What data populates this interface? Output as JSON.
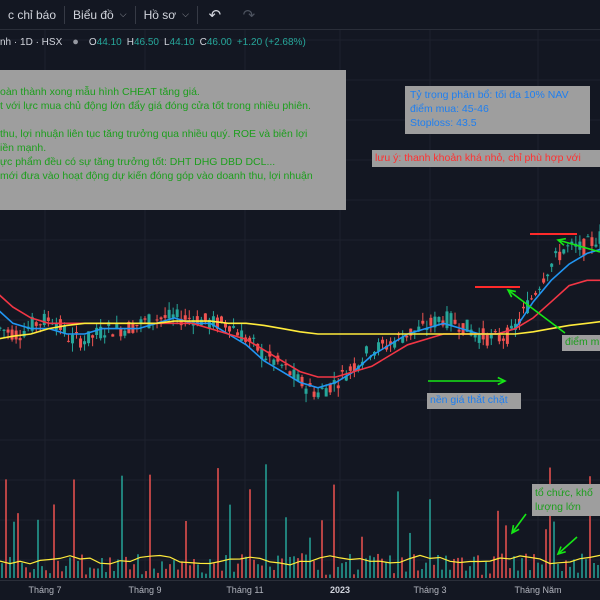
{
  "toolbar": {
    "indicators_label": "c chỉ báo",
    "chart_label": "Biểu đồ",
    "profile_label": "Hồ sơ",
    "undo_icon": "undo-icon",
    "redo_icon": "redo-icon"
  },
  "legend": {
    "symbol": "nh · 1D · HSX",
    "o_label": "O",
    "o_value": "44.10",
    "h_label": "H",
    "h_value": "46.50",
    "l_label": "L",
    "l_value": "44.10",
    "c_label": "C",
    "c_value": "46.00",
    "change": "+1.20 (+2.68%)"
  },
  "notes": {
    "lines": [
      "oàn thành xong mẫu hình CHEAT tăng giá.",
      "t với lực mua chủ động lớn đẩy giá đóng cửa tốt trong nhiều phiên.",
      "",
      "thu, lợi nhuận liên tục tăng trưởng qua nhiều quý. ROE và biên lợi",
      "iền mạnh.",
      "ực phẩm đều có sự tăng trưởng tốt: DHT DHG DBD DCL...",
      "mới đưa vào hoạt động dự kiến đóng góp vào doanh thu, lợi nhuận"
    ],
    "allocation": [
      "Tỷ trọng phân bổ: tối đa 10% NAV",
      "điểm mua: 45-46",
      "Stoploss: 43.5"
    ],
    "warning": "lưu ý: thanh khoản khá nhỏ, chỉ phù hợp với",
    "buy_point": "điểm m",
    "tight_base": "nền giá thắt chặt",
    "institution": [
      "tổ chức, khố",
      "lượng lớn"
    ]
  },
  "colors": {
    "background": "#131722",
    "up": "#26a69a",
    "down": "#ef5350",
    "ma_fast": "#2196f3",
    "ma_mid": "#f23645",
    "ma_slow": "#ffeb3b",
    "note_bg": "#9e9e9e",
    "note_green": "#1d9e1d",
    "note_blue": "#1f7ff0",
    "note_red": "#ff3030"
  },
  "xaxis": {
    "labels": [
      "Tháng 7",
      "Tháng 9",
      "Tháng 11",
      "2023",
      "Tháng 3",
      "Tháng Năm"
    ]
  },
  "chart_data": {
    "type": "candlestick",
    "x": [
      "Tháng 7",
      "Tháng 9",
      "Tháng 11",
      "2023",
      "Tháng 3",
      "Tháng Năm"
    ],
    "close": [
      37.5,
      37,
      38,
      38.5,
      36.5,
      36.5,
      37.5,
      37.5,
      38,
      38.5,
      38.5,
      38.5,
      38,
      38,
      36.5,
      35,
      34,
      32.5,
      31.5,
      32.5,
      34,
      35.5,
      36,
      37,
      37.5,
      38.5,
      38,
      37,
      36.5,
      37,
      40,
      43,
      45,
      45,
      46
    ],
    "series": [
      {
        "name": "MA fast",
        "values": [
          39.5,
          38,
          37.5,
          37.5,
          37,
          37,
          37.5,
          37.5,
          37.5,
          38,
          38.5,
          38,
          38,
          37,
          36,
          34.5,
          33.5,
          32.5,
          32,
          32.5,
          33.5,
          35,
          36,
          37,
          37.5,
          38,
          37.5,
          37,
          37,
          37.5,
          40,
          42,
          43.5,
          44.5,
          45
        ]
      },
      {
        "name": "MA mid",
        "values": [
          41,
          39.5,
          38.5,
          38,
          38,
          38,
          38,
          38,
          38,
          38,
          38,
          38,
          37.5,
          37,
          36.5,
          35.5,
          34.5,
          33.5,
          33,
          33,
          33.5,
          34,
          35,
          36,
          36.5,
          37,
          37,
          37,
          37,
          37.5,
          38.5,
          40,
          41.5,
          42,
          42
        ]
      },
      {
        "name": "MA slow",
        "values": [
          36.5,
          36.8,
          37,
          37.5,
          37.8,
          38,
          38,
          38,
          38,
          38,
          38.2,
          38.2,
          38.2,
          38,
          38,
          37.8,
          37.5,
          37.2,
          37,
          37,
          37,
          37,
          37,
          37,
          37,
          37,
          37,
          37,
          37,
          37,
          37.2,
          37.5,
          37.8,
          38,
          38.2
        ]
      }
    ],
    "volume_spikes": "periodic",
    "ylim": [
      29,
      49
    ]
  }
}
